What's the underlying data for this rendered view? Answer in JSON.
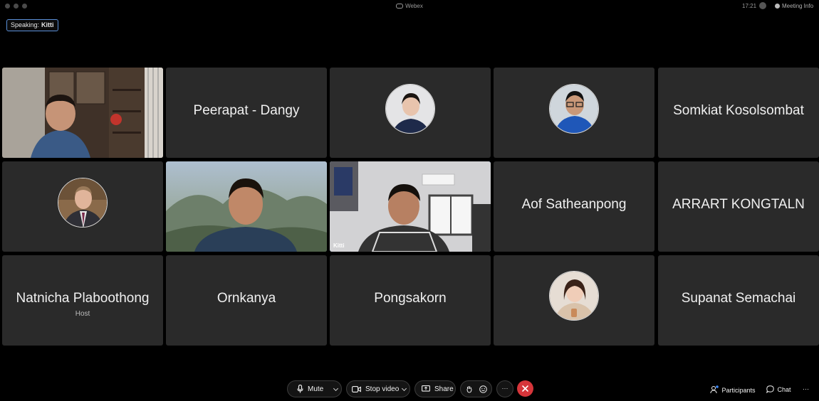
{
  "window": {
    "app_title": "Webex",
    "time": "17:21",
    "meeting_info_label": "Meeting Info"
  },
  "speaking": {
    "label": "Speaking:",
    "name": "Kitti"
  },
  "participants": [
    {
      "type": "video",
      "name": "",
      "desc": "man smiling in front of glass cabinet"
    },
    {
      "type": "name",
      "name": "Peerapat - Dangy"
    },
    {
      "type": "avatar",
      "name": "",
      "desc": "woman in navy polo"
    },
    {
      "type": "avatar",
      "name": "",
      "desc": "man with glasses in blue jacket"
    },
    {
      "type": "name",
      "name": "Somkiat Kosolsombat"
    },
    {
      "type": "avatar",
      "name": "",
      "desc": "man in suit"
    },
    {
      "type": "video",
      "name": "",
      "desc": "man with blurred mountain background"
    },
    {
      "type": "video",
      "name": "Kitti",
      "active": true
    },
    {
      "type": "name",
      "name": "Aof Satheanpong"
    },
    {
      "type": "name",
      "name": "ARRART KONGTALN"
    },
    {
      "type": "name",
      "name": "Natnicha Plaboothong",
      "role": "Host"
    },
    {
      "type": "name",
      "name": "Ornkanya"
    },
    {
      "type": "name",
      "name": "Pongsakorn"
    },
    {
      "type": "avatar",
      "name": "",
      "desc": "woman in beige top"
    },
    {
      "type": "name",
      "name": "Supanat Semachai"
    }
  ],
  "controls": {
    "mute_label": "Mute",
    "stop_video_label": "Stop video",
    "share_label": "Share",
    "more_label": "···",
    "participants_label": "Participants",
    "chat_label": "Chat",
    "overflow_label": "···"
  },
  "colors": {
    "tile_bg": "#2a2a2a",
    "active_border": "#5aa8e8",
    "speaking_border": "#5a8fd8",
    "end_call": "#d6353a",
    "participants_dot": "#3d8bff"
  }
}
